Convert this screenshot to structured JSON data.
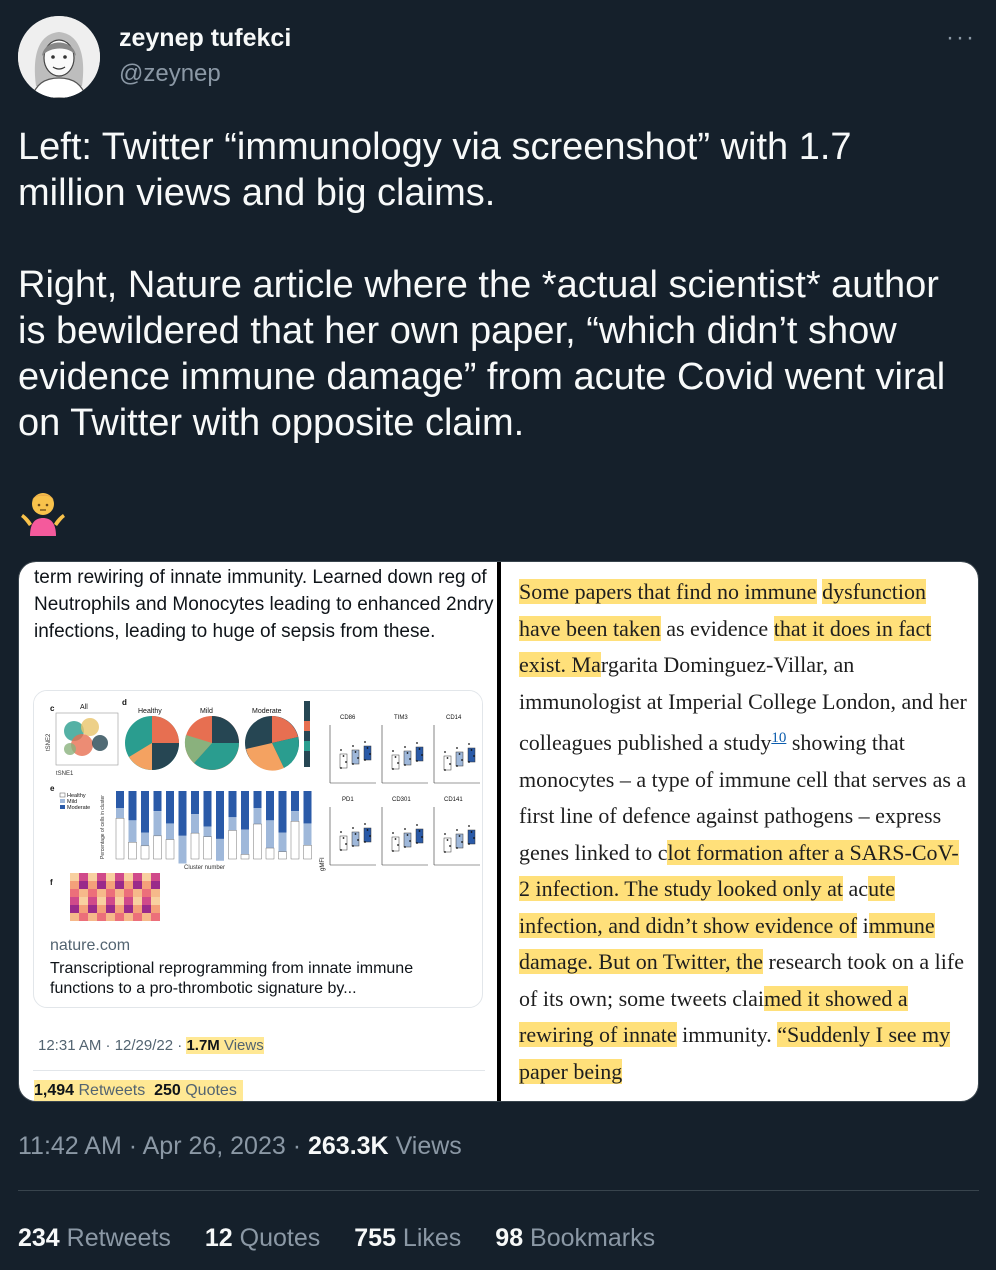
{
  "author": {
    "name": "zeynep tufekci",
    "handle": "@zeynep"
  },
  "more_label": "···",
  "tweet": {
    "text": "Left: Twitter “immunology via screenshot” with 1.7 million views and big claims.\n\nRight, Nature article where the *actual scientist* author is bewildered that her own paper, “which didn’t show evidence immune damage” from acute Covid went viral on Twitter with opposite claim.",
    "emoji": "person-shrugging-emoji"
  },
  "left_screenshot": {
    "text": "term rewiring of innate immunity. Learned down reg of Neutrophils and Monocytes leading to enhanced 2ndry infections, leading to huge of sepsis from these.",
    "figure_labels": {
      "panel_c": "c",
      "panel_d": "d",
      "panel_e": "e",
      "panel_f": "f",
      "all": "All",
      "healthy": "Healthy",
      "mild": "Mild",
      "moderate": "Moderate",
      "tsne1": "tSNE1",
      "tsne2": "tSNE2",
      "cd86": "CD86",
      "tim3": "TIM3",
      "cd14": "CD14",
      "pd1": "PD1",
      "cd301": "CD301",
      "cd141": "CD141",
      "cluster_number": "Cluster number",
      "pct_cells": "Percentage of cells in cluster",
      "gmfi": "gMFI"
    },
    "card": {
      "domain": "nature.com",
      "title": "Transcriptional reprogramming from innate immune functions to a pro-thrombotic signature by..."
    },
    "meta": {
      "time": "12:31 AM · 12/29/22 · ",
      "views_count": "1.7M",
      "views_label": " Views"
    },
    "stats": {
      "retweets_count": "1,494",
      "retweets_label": " Retweets",
      "quotes_count": "250",
      "quotes_label": " Quotes"
    }
  },
  "right_screenshot": {
    "p1": "Some papers that find no immune",
    "p2": "dysfunction have been taken",
    "p3": " as evidence",
    "p4": "that it does in fact exist. Ma",
    "p5": "rgarita",
    "p6": "Dominguez-Villar, an immunologist at Imperial College London, and her colleagues published a study",
    "ref": "10",
    "p7": " showing that monocytes – a type of immune cell that serves as a first line of defence against pathogens – express genes linked to c",
    "p8": "lot formation after a SARS-CoV-2 infection. ",
    "p9": "The study looked only at",
    "p10": " ac",
    "p11": "ute infection, and didn’t show evidence of",
    "p12": " i",
    "p13": "mmune damage. But on Twitter, the",
    "p14": " research took on a life of its own; some tweets clai",
    "p15": "med it showed a rewiring of innate",
    "p16": " immunity. ",
    "p17": "“Suddenly I see my paper being"
  },
  "timestamp": {
    "time": "11:42 AM · Apr 26, 2023 · ",
    "views_count": "263.3K",
    "views_label": " Views"
  },
  "stats": [
    {
      "count": "234",
      "label": " Retweets"
    },
    {
      "count": "12",
      "label": " Quotes"
    },
    {
      "count": "755",
      "label": " Likes"
    },
    {
      "count": "98",
      "label": " Bookmarks"
    }
  ]
}
